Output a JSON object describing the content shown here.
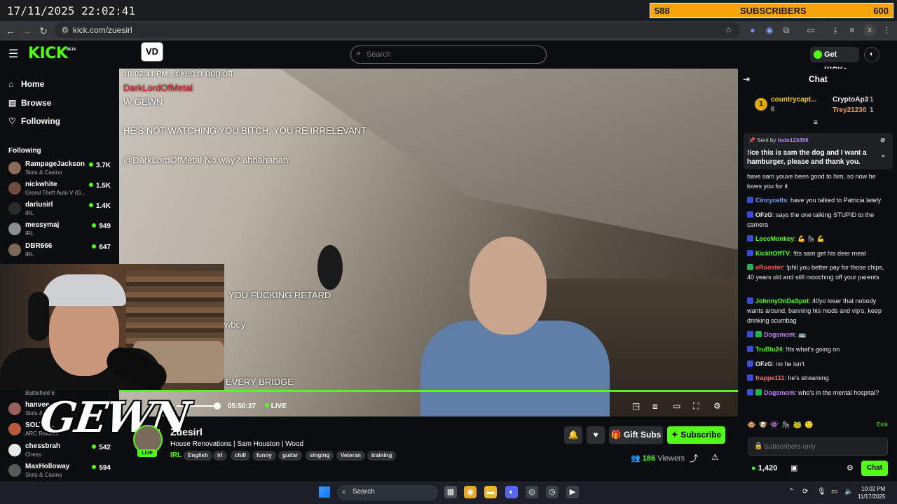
{
  "overlay": {
    "timestamp": "17/11/2025 22:02:41",
    "sub_goal_start": "588",
    "sub_goal_label": "SUBSCRIBERS",
    "sub_goal_end": "600"
  },
  "browser": {
    "url": "kick.com/zuesirl",
    "profile_initial": "X"
  },
  "header": {
    "logo": "KICK",
    "logo_badge": "BETA",
    "channel_logo": "VD",
    "search_placeholder": "Search",
    "get_kicks_label": "Get KICKs"
  },
  "sidebar": {
    "nav": [
      {
        "label": "Home",
        "icon": "home-icon"
      },
      {
        "label": "Browse",
        "icon": "browse-icon"
      },
      {
        "label": "Following",
        "icon": "heart-icon"
      }
    ],
    "following_heading": "Following",
    "following": [
      {
        "name": "RampageJackson",
        "category": "Slots & Casino",
        "viewers": "3.7K"
      },
      {
        "name": "nickwhite",
        "category": "Grand Theft Auto V (G...",
        "viewers": "1.5K"
      },
      {
        "name": "dariusirl",
        "category": "IRL",
        "viewers": "1.4K"
      },
      {
        "name": "messymaj",
        "category": "IRL",
        "viewers": "949"
      },
      {
        "name": "DBR666",
        "category": "IRL",
        "viewers": "647"
      }
    ],
    "following_lower": [
      {
        "name": "",
        "category": "Battlefield 6",
        "viewers": ""
      },
      {
        "name": "hanvee",
        "category": "Slots & C...",
        "viewers": ""
      },
      {
        "name": "SOLTE...",
        "category": "ARC Raiders",
        "viewers": ""
      },
      {
        "name": "chessbrah",
        "category": "Chess",
        "viewers": "542"
      },
      {
        "name": "MaxHolloway",
        "category": "Slots & Casino",
        "viewers": "594"
      }
    ]
  },
  "video": {
    "clock": "10:02:41 PM",
    "overlay_lines": [
      "...cked a dog off",
      "DarkLordOfMetal",
      "W GEWN",
      "HE'S NOT WATCHING YOU BITCH, YOU'RE IRRELEVANT",
      "@DarkLordOfMetal No way? ahhahahah",
      "YOU FUCKING RETARD",
      "wboy",
      "EVERY BRIDGE"
    ],
    "elapsed": "05:50:37",
    "live_label": "LIVE",
    "progress": 1.0,
    "volume": 0.9
  },
  "webcam_overlay_text": "GEWN",
  "channel": {
    "name": "Zuesirl",
    "title": "House Renovations | Sam Houston | Wood",
    "category": "IRL",
    "live_badge": "LIVE",
    "tags": [
      "English",
      "irl",
      "chill",
      "funny",
      "guitar",
      "singing",
      "Veteran",
      "training"
    ],
    "gift_label": "Gift Subs",
    "subscribe_label": "Subscribe",
    "viewers_count": "186",
    "viewers_label": "Viewers"
  },
  "chat": {
    "title": "Chat",
    "leaderboard": [
      {
        "rank": "1",
        "name": "countrycapt...",
        "count": "6"
      },
      {
        "name": "CryptoAp3",
        "count": "1"
      },
      {
        "name": "Trey21230",
        "count": "1"
      }
    ],
    "pinned": {
      "sent_by_label": "Sent by",
      "sender": "todo123456",
      "message": "!ice this is sam the dog and I want a hamburger, please and thank you."
    },
    "messages": [
      {
        "user": "",
        "color": "#e9ecef",
        "text": "have sam youve been good to him, so now he loves you for it"
      },
      {
        "user": "Cincycelts",
        "color": "#7aa2ff",
        "text": "have you talked to Patricia lately"
      },
      {
        "user": "OFzG",
        "color": "#e9ecef",
        "text": "says the one talking STUPID to the camera"
      },
      {
        "user": "LocoMonkey",
        "color": "#53fc18",
        "text": "💪 🦍 💪"
      },
      {
        "user": "KickItOffTV",
        "color": "#53fc18",
        "text": "!tts sam get his deer meat"
      },
      {
        "user": "vRooster",
        "color": "#ff5a5a",
        "text": "!phil you better pay for those chips, 40 years old and still mooching off your parents"
      },
      {
        "user": "JohnnyOnDaSpot",
        "color": "#53fc18",
        "text": "40yo loser that nobody wants around, banning his mods and vip's, keep drinking scumbag"
      },
      {
        "user": "Dogsmom",
        "color": "#c77dff",
        "text": "🚌"
      },
      {
        "user": "TruBlu24",
        "color": "#53fc18",
        "text": "!tts what's going on"
      },
      {
        "user": "OFzG",
        "color": "#e9ecef",
        "text": "no he isn't"
      },
      {
        "user": "frappe111",
        "color": "#ff6b6b",
        "text": "he's streaming"
      },
      {
        "user": "Dogsmom",
        "color": "#c77dff",
        "text": "who's in the mental hospital?"
      }
    ],
    "emote_strip_text": "Emk",
    "input_placeholder": "Subscribers only",
    "points": "1,420",
    "send_label": "Chat"
  },
  "taskbar": {
    "search_label": "Search",
    "time": "10:02 PM",
    "date": "11/17/2025"
  },
  "colors": {
    "kick_green": "#53fc18",
    "goal_orange": "#f5a50a",
    "background": "#0b0e0f"
  }
}
